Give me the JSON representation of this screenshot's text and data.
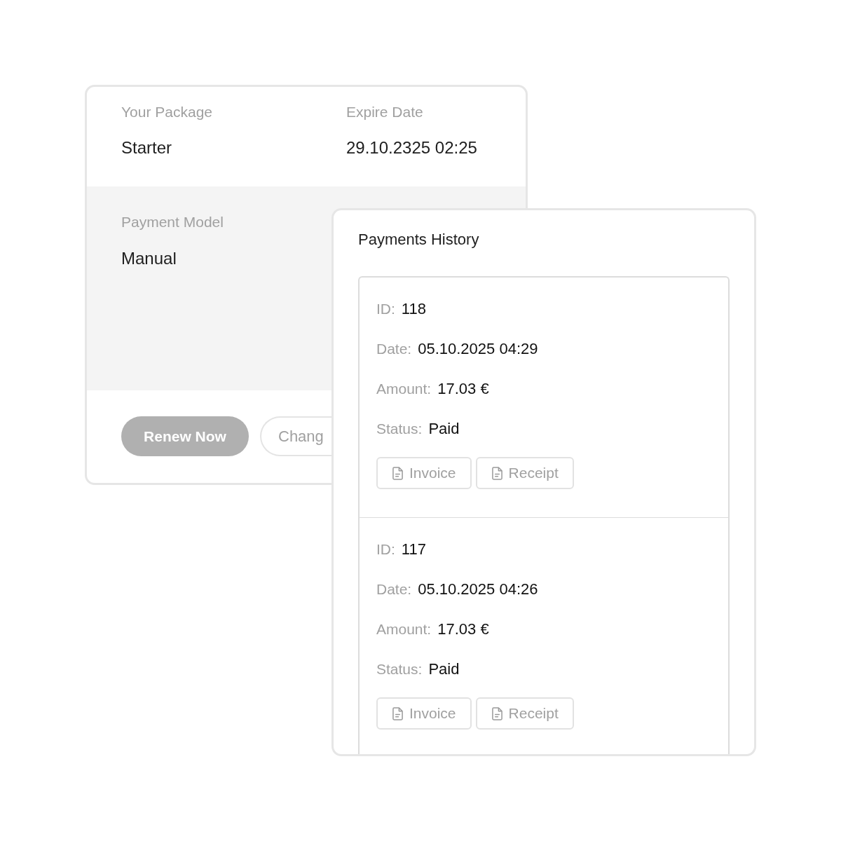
{
  "package_card": {
    "fields": [
      {
        "label": "Your Package",
        "value": "Starter"
      },
      {
        "label": "Expire Date",
        "value": "29.10.2325 02:25"
      }
    ],
    "payment": {
      "label": "Payment Model",
      "value": "Manual"
    },
    "buttons": [
      {
        "label": "Renew Now",
        "kind": "primary"
      },
      {
        "label": "Chang",
        "kind": "secondary"
      }
    ]
  },
  "payments_history": {
    "title": "Payments History",
    "payments": [
      {
        "fields": [
          {
            "label": "ID:",
            "value": "118"
          },
          {
            "label": "Date:",
            "value": "05.10.2025 04:29"
          },
          {
            "label": "Amount:",
            "value": "17.03 €"
          },
          {
            "label": "Status:",
            "value": "Paid"
          }
        ],
        "actions": [
          "Invoice",
          "Receipt"
        ]
      },
      {
        "fields": [
          {
            "label": "ID:",
            "value": "117"
          },
          {
            "label": "Date:",
            "value": "05.10.2025 04:26"
          },
          {
            "label": "Amount:",
            "value": "17.03 €"
          },
          {
            "label": "Status:",
            "value": "Paid"
          }
        ],
        "actions": [
          "Invoice",
          "Receipt"
        ]
      }
    ]
  }
}
